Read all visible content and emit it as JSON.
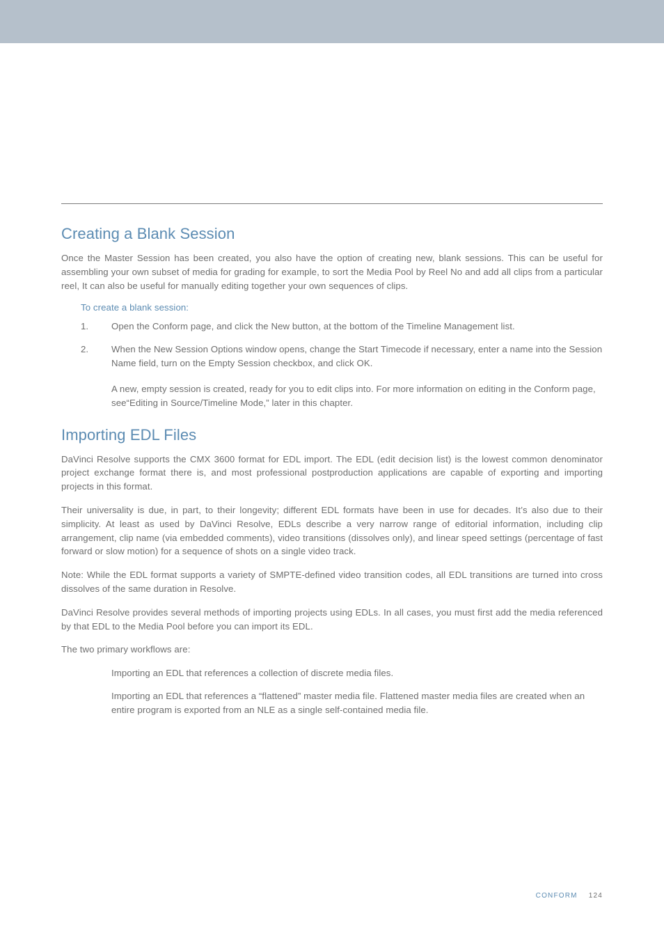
{
  "section1": {
    "title": "Creating a Blank Session",
    "intro": "Once the Master Session has been created, you also have the option of creating new, blank sessions. This can be useful for assembling your own subset of media for grading for example, to sort the Media Pool by Reel No and add all clips from a particular reel, It can also be useful for manually editing together your own sequences of clips.",
    "subhead": "To create a blank session:",
    "steps": [
      {
        "num": "1.",
        "text": "Open the Conform page, and click the New button, at the bottom of the Timeline Management list."
      },
      {
        "num": "2.",
        "text": "When the New Session Options window opens, change the Start Timecode if necessary, enter a name into the Session Name field, turn on the Empty Session checkbox, and click OK."
      }
    ],
    "note": "A new, empty session is created, ready for you to edit clips into. For more information on editing in the Conform page, see“Editing in Source/Timeline Mode,” later in this chapter."
  },
  "section2": {
    "title": "Importing EDL Files",
    "p1": "DaVinci Resolve supports the CMX 3600 format for EDL import. The EDL (edit decision list) is the lowest common denominator project exchange format there is, and most professional postproduction applications are capable of exporting and importing projects in this format.",
    "p2": "Their universality is due, in part, to their longevity; different EDL formats have been in use for decades. It’s also due to their simplicity. At least as used by DaVinci Resolve, EDLs describe a very narrow range of editorial information, including clip arrangement, clip name (via embedded comments), video transitions (dissolves only), and linear speed settings (percentage of fast forward or slow motion) for a sequence of shots on a single video track.",
    "p3": "Note: While the EDL format supports a variety of SMPTE-defined video transition codes, all EDL transitions are turned into cross dissolves of the same duration in Resolve.",
    "p4": "DaVinci Resolve provides several methods of importing projects using EDLs. In all cases, you must first add the media referenced by that EDL to the Media Pool before you can import its EDL.",
    "p5": "The two primary workflows are:",
    "workflows": [
      "Importing an EDL that references a collection of discrete media files.",
      "Importing an EDL that references a “flattened” master media file. Flattened master media files are created when an entire program is exported from an NLE as a single self-contained media file."
    ]
  },
  "footer": {
    "label": "CONFORM",
    "page": "124"
  }
}
